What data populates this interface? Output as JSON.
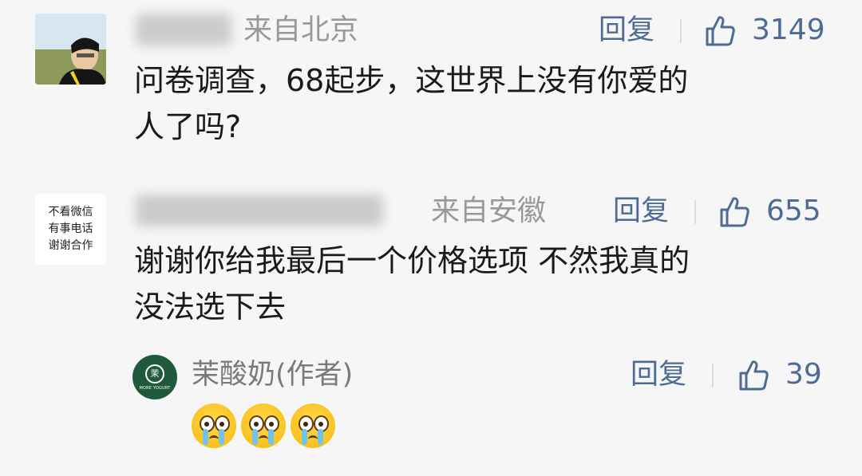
{
  "comments": [
    {
      "location": "来自北京",
      "reply_label": "回复",
      "likes": "3149",
      "text_lines": [
        "问卷调查，68起步，这世界上没有你爱的",
        "人了吗?"
      ]
    },
    {
      "avatar_text": [
        "不看微信",
        "有事电话",
        "谢谢合作"
      ],
      "location": "来自安徽",
      "reply_label": "回复",
      "likes": "655",
      "text_lines": [
        "谢谢你给我最后一个价格选项 不然我真的",
        "没法选下去"
      ],
      "author_reply": {
        "name": "茉酸奶(作者)",
        "reply_label": "回复",
        "likes": "39",
        "logo_mark": "茉",
        "logo_text": "MORE YOGURT",
        "emojis": [
          "crying-face-icon",
          "crying-face-icon",
          "crying-face-icon"
        ]
      }
    }
  ],
  "colors": {
    "background": "#f6f6f6",
    "link": "#4d6b94",
    "muted": "#999999",
    "text": "#1a1a1a",
    "brand_green": "#1f5a3c"
  }
}
